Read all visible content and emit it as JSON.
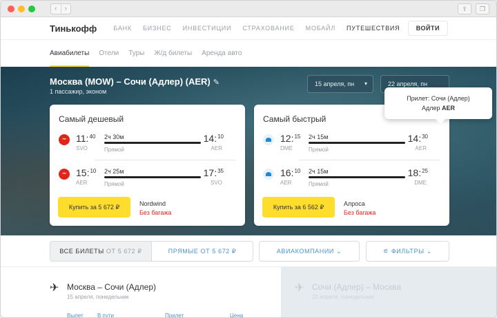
{
  "browser": {
    "back": "‹",
    "forward": "›",
    "share_icon": "share-icon",
    "tabs_icon": "tabs-icon"
  },
  "header": {
    "logo": "Тинькофф",
    "nav": [
      "БАНК",
      "БИЗНЕС",
      "ИНВЕСТИЦИИ",
      "СТРАХОВАНИЕ",
      "МОБАЙЛ",
      "ПУТЕШЕСТВИЯ"
    ],
    "active_nav": "ПУТЕШЕСТВИЯ",
    "login": "ВОЙТИ"
  },
  "subnav": [
    "Авиабилеты",
    "Отели",
    "Туры",
    "Ж/д билеты",
    "Аренда авто"
  ],
  "search": {
    "route": "Москва (MOW) – Сочи (Адлер) (AER)",
    "passengers": "1 пассажир, эконом",
    "date_out": "15 апреля, пн",
    "date_back": "22 апреля, пн"
  },
  "tooltip": {
    "line1": "Прилет: Сочи (Адлер)",
    "line2_prefix": "Адлер ",
    "line2_code": "AER"
  },
  "cards": [
    {
      "title": "Самый дешевый",
      "segments": [
        {
          "dep_h": "11",
          "dep_m": "40",
          "dep_code": "SVO",
          "duration": "2ч 30м",
          "stops": "Прямой",
          "arr_h": "14",
          "arr_m": "10",
          "arr_code": "AER"
        },
        {
          "dep_h": "15",
          "dep_m": "10",
          "dep_code": "AER",
          "duration": "2ч 25м",
          "stops": "Прямой",
          "arr_h": "17",
          "arr_m": "35",
          "arr_code": "SVO"
        }
      ],
      "buy": "Купить за 5 672 ₽",
      "carrier": "Nordwind",
      "baggage": "Без багажа"
    },
    {
      "title": "Самый быстрый",
      "segments": [
        {
          "dep_h": "12",
          "dep_m": "15",
          "dep_code": "DME",
          "duration": "2ч 15м",
          "stops": "Прямой",
          "arr_h": "14",
          "arr_m": "30",
          "arr_code": "AER"
        },
        {
          "dep_h": "16",
          "dep_m": "10",
          "dep_code": "AER",
          "duration": "2ч 15м",
          "stops": "Прямой",
          "arr_h": "18",
          "arr_m": "25",
          "arr_code": "DME"
        }
      ],
      "buy": "Купить за 6 562 ₽",
      "carrier": "Алроса",
      "baggage": "Без багажа"
    }
  ],
  "filters": {
    "all_label": "ВСЕ БИЛЕТЫ",
    "all_from": "ОТ 5 672 ₽",
    "direct": "ПРЯМЫЕ ОТ 5 672 ₽",
    "airlines": "АВИАКОМПАНИИ",
    "filters": "ФИЛЬТРЫ"
  },
  "results": {
    "out_title": "Москва – Сочи (Адлер)",
    "out_date": "15 апреля, понедельник",
    "back_title": "Сочи (Адлер) – Москва",
    "back_date": "22 апреля, понедельник",
    "columns": [
      "Вылет",
      "В пути",
      "Прилет",
      "Цена"
    ]
  },
  "colors": {
    "accent_yellow": "#ffdd2d",
    "link_blue": "#4c92c9",
    "danger_red": "#e0261b"
  }
}
